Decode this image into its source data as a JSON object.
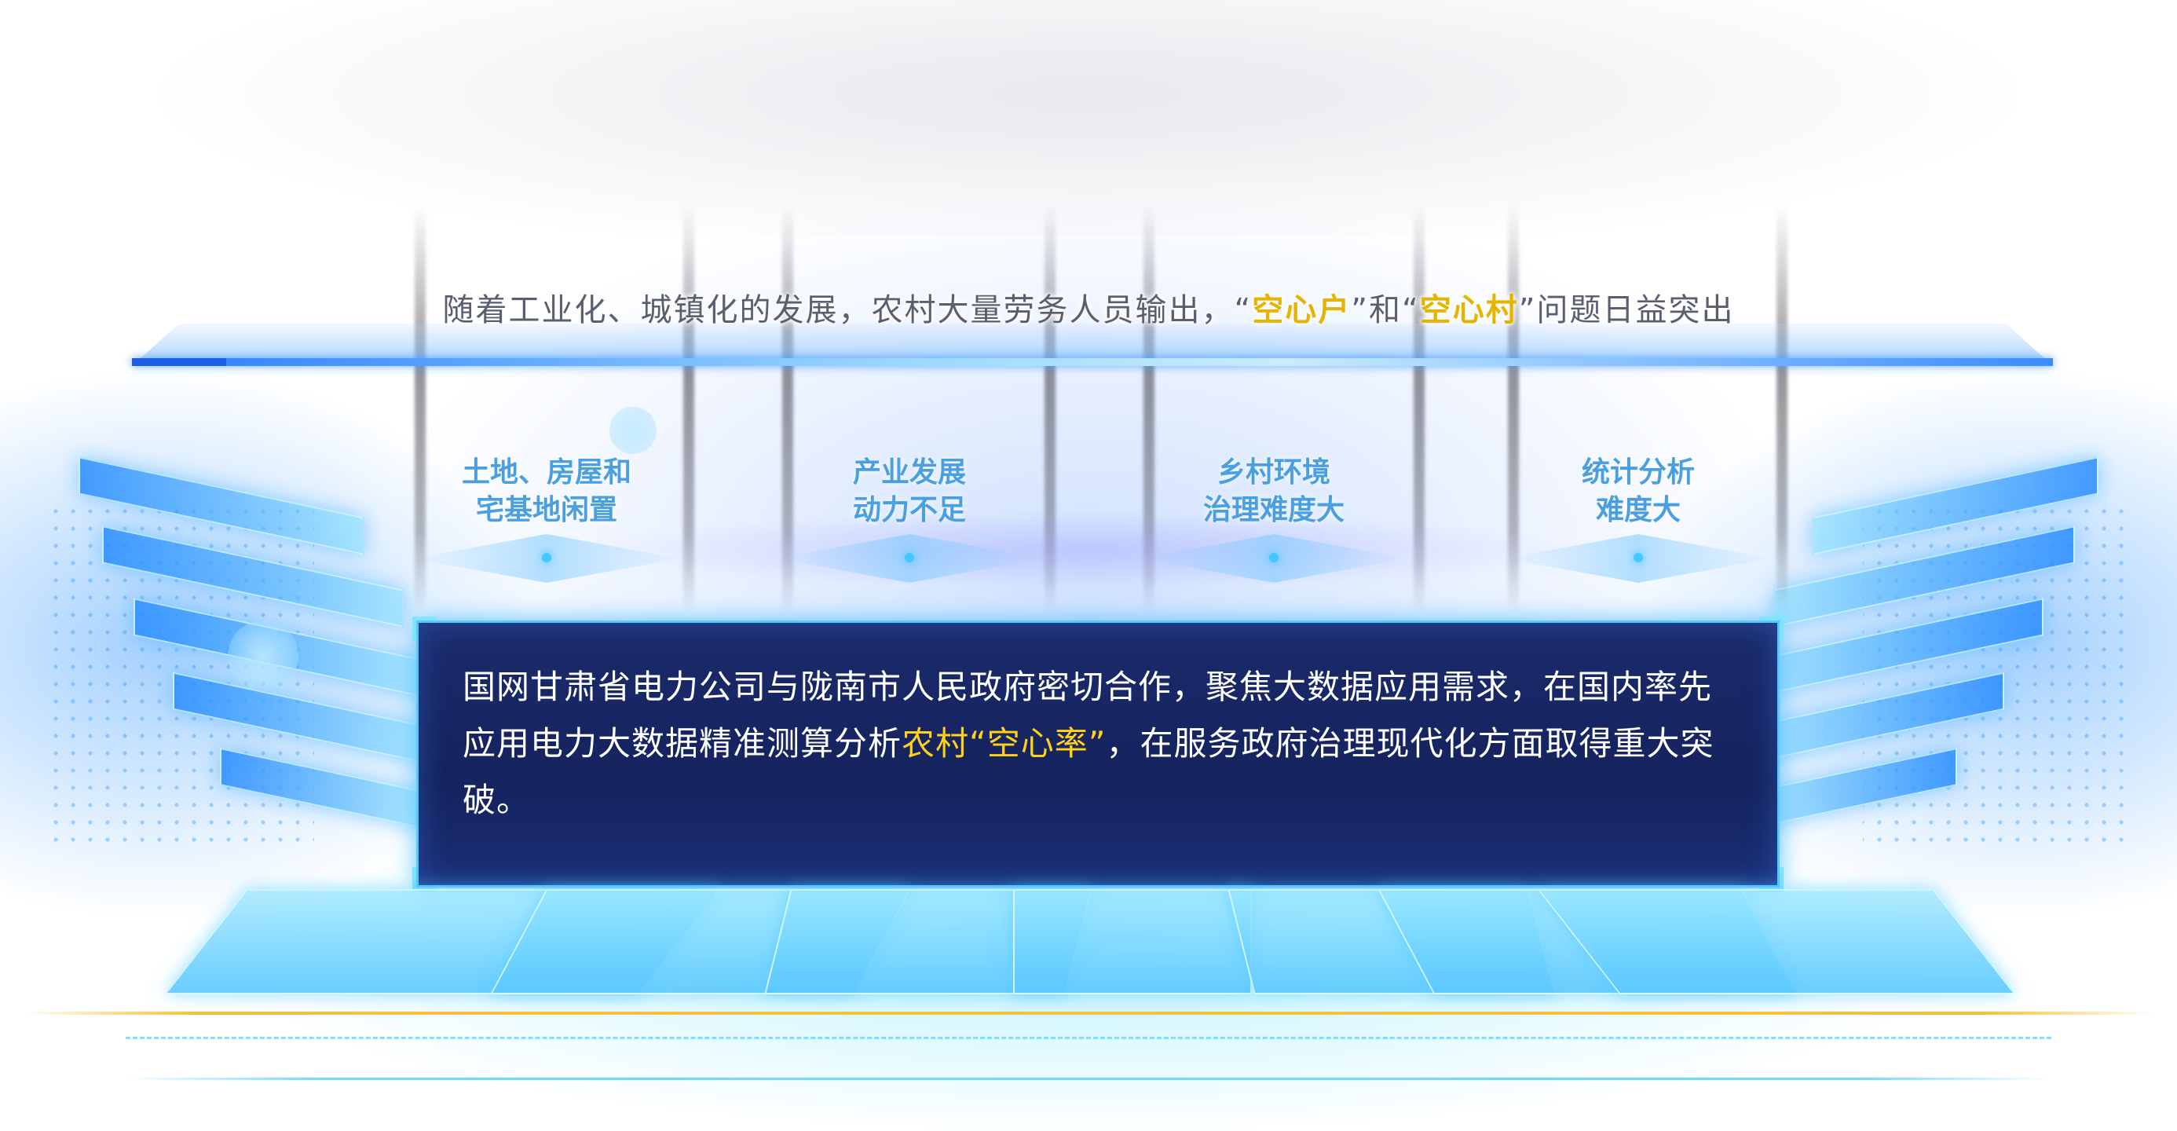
{
  "header": {
    "text_before": "随着工业化、城镇化的发展，农村大量劳务人员输出，",
    "quote_open_1": "“",
    "highlight_1": "空心户",
    "quote_close_1": "”",
    "conjunction": "和",
    "quote_open_2": "“",
    "highlight_2": "空心村",
    "quote_close_2": "”",
    "text_after": "问题日益突出"
  },
  "issues": [
    {
      "line1": "土地、房屋和",
      "line2": "宅基地闲置"
    },
    {
      "line1": "产业发展",
      "line2": "动力不足"
    },
    {
      "line1": "乡村环境",
      "line2": "治理难度大"
    },
    {
      "line1": "统计分析",
      "line2": "难度大"
    }
  ],
  "panel": {
    "text_before": "国网甘肃省电力公司与陇南市人民政府密切合作，聚焦大数据应用需求，在国内率先应用电力大数据精准测算分析",
    "highlight": "农村“空心率”",
    "text_after": "，在服务政府治理现代化方面取得重大突破。"
  },
  "colors": {
    "highlight_header": "#e6b400",
    "highlight_panel": "#ffd21a",
    "panel_bg": "#1b2a6b",
    "panel_border": "#58c8ff",
    "issue_text": "#4a9fe0",
    "accent_blue": "#2a7bff"
  }
}
